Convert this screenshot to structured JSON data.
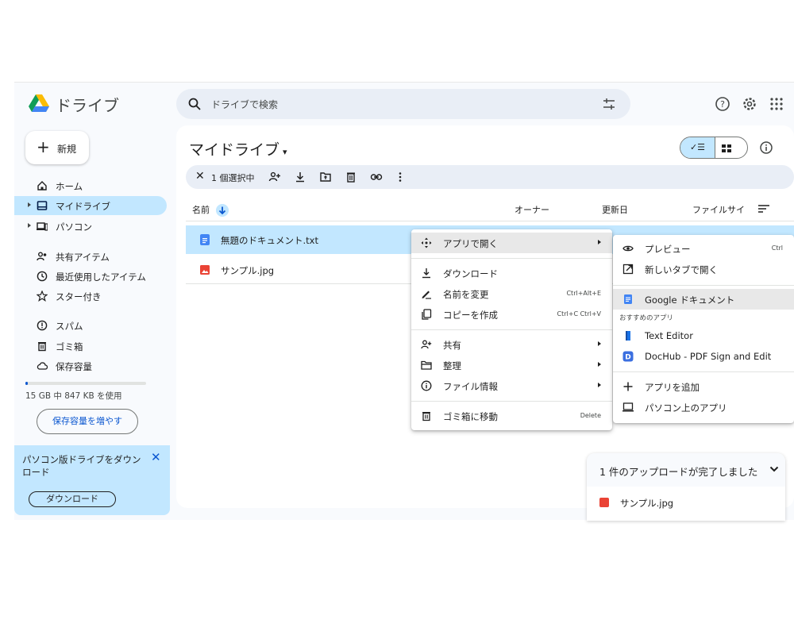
{
  "app": {
    "name": "ドライブ"
  },
  "search": {
    "placeholder": "ドライブで検索"
  },
  "sidebar": {
    "new_label": "新規",
    "items": [
      {
        "label": "ホーム",
        "icon": "home-icon"
      },
      {
        "label": "マイドライブ",
        "icon": "my-drive-icon",
        "active": true
      },
      {
        "label": "パソコン",
        "icon": "computer-icon"
      },
      {
        "label": "共有アイテム",
        "icon": "shared-icon"
      },
      {
        "label": "最近使用したアイテム",
        "icon": "clock-icon"
      },
      {
        "label": "スター付き",
        "icon": "star-icon"
      },
      {
        "label": "スパム",
        "icon": "spam-icon"
      },
      {
        "label": "ゴミ箱",
        "icon": "trash-icon"
      },
      {
        "label": "保存容量",
        "icon": "cloud-icon"
      }
    ],
    "storage_text": "15 GB 中 847 KB を使用",
    "storage_used_fraction": 0.0001,
    "storage_button": "保存容量を増やす",
    "promo_text": "パソコン版ドライブをダウンロード",
    "promo_close": "✕",
    "promo_button": "ダウンロード"
  },
  "main": {
    "title": "マイドライブ",
    "title_caret": "▾",
    "view_list_label": "✓☰",
    "selection": {
      "close": "✕",
      "count_label": "1 個選択中"
    },
    "columns": {
      "name": "名前",
      "owner": "オーナー",
      "modified": "更新日",
      "size": "ファイルサイ"
    },
    "files": [
      {
        "name": "無題のドキュメント.txt",
        "type": "doc",
        "color": "#4285f4",
        "selected": true
      },
      {
        "name": "サンプル.jpg",
        "type": "image",
        "color": "#ea4335",
        "selected": false
      }
    ]
  },
  "context_menu": {
    "items": [
      {
        "label": "アプリで開く",
        "icon": "open-with-icon",
        "submenu": true,
        "highlighted": true
      },
      {
        "label": "ダウンロード",
        "icon": "download-icon"
      },
      {
        "label": "名前を変更",
        "icon": "rename-icon",
        "shortcut": "Ctrl+Alt+E"
      },
      {
        "label": "コピーを作成",
        "icon": "copy-icon",
        "shortcut": "Ctrl+C Ctrl+V"
      },
      {
        "label": "共有",
        "icon": "share-icon",
        "submenu": true
      },
      {
        "label": "整理",
        "icon": "folder-icon",
        "submenu": true
      },
      {
        "label": "ファイル情報",
        "icon": "info-icon",
        "submenu": true
      },
      {
        "label": "ゴミ箱に移動",
        "icon": "trash-icon",
        "shortcut": "Delete"
      }
    ]
  },
  "submenu": {
    "items": [
      {
        "label": "プレビュー",
        "icon": "eye-icon",
        "shortcut": "Ctrl"
      },
      {
        "label": "新しいタブで開く",
        "icon": "open-in-new-icon"
      },
      {
        "label": "Google ドキュメント",
        "icon": "google-docs-icon",
        "highlighted": true
      },
      {
        "label": "Text Editor",
        "icon": "text-editor-icon"
      },
      {
        "label": "DocHub - PDF Sign and Edit",
        "icon": "dochub-icon"
      },
      {
        "label": "アプリを追加",
        "icon": "plus-icon"
      },
      {
        "label": "パソコン上のアプリ",
        "icon": "computer-icon"
      }
    ],
    "section_label": "おすすめのアプリ"
  },
  "upload": {
    "title": "1 件のアップロードが完了しました",
    "file": "サンプル.jpg"
  },
  "colors": {
    "accent": "#0b57d0",
    "selected": "#c2e7ff",
    "surface": "#f8fafd"
  }
}
